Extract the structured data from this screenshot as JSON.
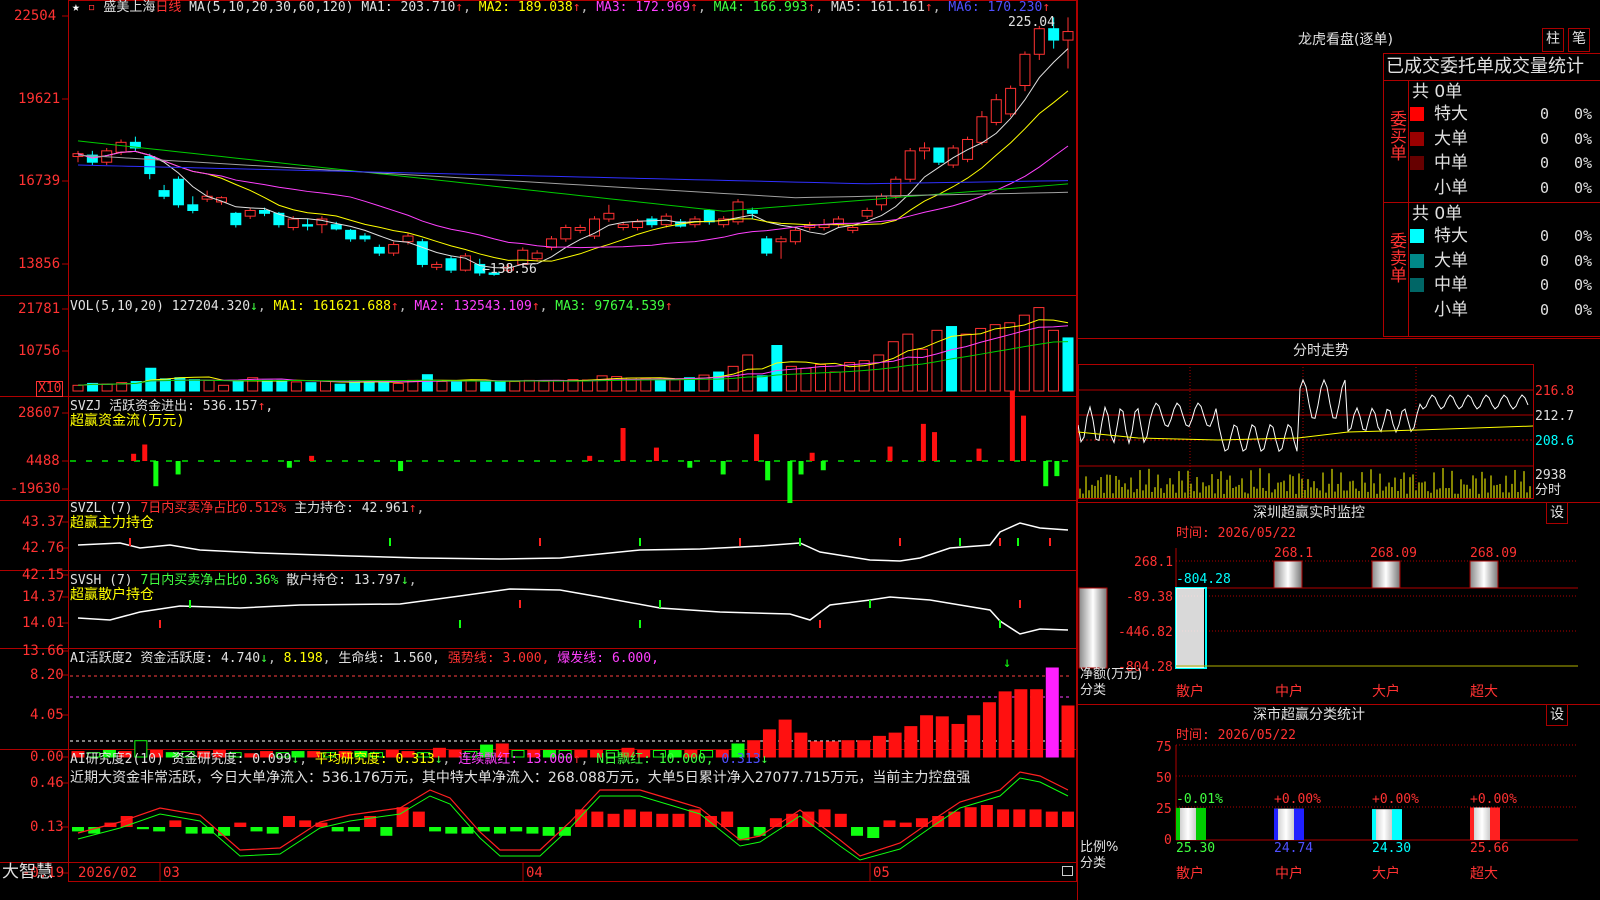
{
  "kline": {
    "stock_name": "盛美上海",
    "period": "日线",
    "ma_params": "MA(5,10,20,30,60,120)",
    "ma1": "MA1: 203.710",
    "ma2": "MA2: 189.038",
    "ma3": "MA3: 172.969",
    "ma4": "MA4: 166.993",
    "ma5": "MA5: 161.161",
    "ma6": "MA6: 170.230",
    "high_label": "225.04",
    "low_label": "←138.56",
    "y_ticks": [
      "22504",
      "19621",
      "16739",
      "13856"
    ]
  },
  "vol": {
    "header": "VOL(5,10,20)",
    "value": "127204.320",
    "ma1": "MA1: 161621.688",
    "ma2": "MA2: 132543.109",
    "ma3": "MA3: 97674.539",
    "y_ticks": [
      "21781",
      "10756"
    ],
    "unit_badge": "X10"
  },
  "svzj": {
    "header": "SVZJ  活跃资金进出: 536.157",
    "subtitle": "超赢资金流(万元)",
    "y_ticks": [
      "28607",
      "4488",
      "-19630"
    ]
  },
  "svzl": {
    "header_prefix": "SVZL (7)",
    "header_pct": "7日内买卖净占比0.512%",
    "header_val": "主力持仓: 42.961",
    "subtitle": "超赢主力持仓",
    "y_ticks": [
      "43.37",
      "42.76",
      "42.15"
    ]
  },
  "svsh": {
    "header_prefix": "SVSH (7)",
    "header_pct": "7日内买卖净占比0.36%",
    "header_val": "散户持仓: 13.797",
    "subtitle": "超赢散户持仓",
    "y_ticks": [
      "14.37",
      "14.01",
      "13.66"
    ]
  },
  "ai_active": {
    "header": "AI活跃度2",
    "v1": "资金活跃度: 4.740",
    "v2": "8.198",
    "v3": "生命线: 1.560,",
    "v4": "强势线: 3.000,",
    "v5": "爆发线: 6.000,",
    "y_ticks": [
      "8.20",
      "4.05",
      "0.00"
    ]
  },
  "ai_research": {
    "header": "AI研究度2(10)",
    "v1": "资金研究度: 0.099",
    "v2": "平均研究度: 0.313",
    "v3": "连续飘红: 13.000",
    "v4": "N日飘红: 10.000,",
    "v5": "0.313",
    "commentary": "近期大资金非常活跃，今日大单净流入：536.176万元，其中特大单净流入：268.088万元，大单5日累计净入27077.715万元，当前主力控盘强",
    "y_ticks": [
      "0.46",
      "0.13",
      "-0.19"
    ]
  },
  "time_axis": {
    "labels": [
      "2026/02",
      "03",
      "04",
      "05"
    ]
  },
  "brand": "大智慧",
  "dragon": {
    "title": "龙虎看盘(逐单)",
    "btn1": "柱",
    "btn2": "笔",
    "header": "已成交委托单成交量统计",
    "buy_label": "委买单",
    "sell_label": "委卖单",
    "buy_total": "共 0单",
    "sell_total": "共 0单",
    "buy_rows": [
      {
        "name": "特大",
        "val": "0",
        "pct": "0%",
        "color": "#ff0000"
      },
      {
        "name": "大单",
        "val": "0",
        "pct": "0%",
        "color": "#990000"
      },
      {
        "name": "中单",
        "val": "0",
        "pct": "0%",
        "color": "#660000"
      },
      {
        "name": "小单",
        "val": "0",
        "pct": "0%",
        "color": "#000000"
      }
    ],
    "sell_rows": [
      {
        "name": "特大",
        "val": "0",
        "pct": "0%",
        "color": "#00ffff"
      },
      {
        "name": "大单",
        "val": "0",
        "pct": "0%",
        "color": "#008888"
      },
      {
        "name": "中单",
        "val": "0",
        "pct": "0%",
        "color": "#006666"
      },
      {
        "name": "小单",
        "val": "0",
        "pct": "0%",
        "color": "#000000"
      }
    ]
  },
  "intraday": {
    "title": "分时走势",
    "y_ticks": [
      "216.8",
      "212.7",
      "208.6"
    ],
    "vol_tick": "2938",
    "vol_label": "分时"
  },
  "sz_monitor": {
    "title": "深圳超赢实时监控",
    "set_btn": "设",
    "time": "时间: 2026/05/22",
    "y_ticks": [
      "268.1",
      "-89.38",
      "-446.82",
      "-804.28"
    ],
    "bar_labels": [
      "-804.28",
      "268.1",
      "268.09",
      "268.09"
    ],
    "axis_label_1": "净额(万元)",
    "axis_label_2": "分类",
    "categories": [
      "散户",
      "中户",
      "大户",
      "超大"
    ]
  },
  "sz_classify": {
    "title": "深市超赢分类统计",
    "set_btn": "设",
    "time": "时间: 2026/05/22",
    "y_ticks": [
      "75",
      "50",
      "25",
      "0"
    ],
    "changes": [
      "-0.01%",
      "+0.00%",
      "+0.00%",
      "+0.00%"
    ],
    "values": [
      "25.30",
      "24.74",
      "24.30",
      "25.66"
    ],
    "axis_label_1": "比例%",
    "axis_label_2": "分类",
    "categories": [
      "散户",
      "中户",
      "大户",
      "超大"
    ],
    "colors": [
      "#00cc00",
      "#2020ff",
      "#00ffff",
      "#ff2020"
    ]
  },
  "chart_data": [
    {
      "type": "candlestick",
      "title": "盛美上海 日线",
      "ylim": [
        13200,
        23200
      ],
      "annotations": [
        "225.04",
        "←138.56"
      ],
      "candles": [
        [
          17900,
          18100,
          17700,
          18000
        ],
        [
          17950,
          18100,
          17600,
          17700
        ],
        [
          17700,
          18200,
          17600,
          18100
        ],
        [
          18050,
          18500,
          17950,
          18400
        ],
        [
          18400,
          18600,
          18100,
          18200
        ],
        [
          17900,
          18000,
          17100,
          17300
        ],
        [
          16700,
          16900,
          16400,
          16500
        ],
        [
          17100,
          17200,
          16100,
          16200
        ],
        [
          16200,
          16500,
          15900,
          16000
        ],
        [
          16400,
          16700,
          16300,
          16500
        ],
        [
          16300,
          16500,
          16200,
          16450
        ],
        [
          15900,
          15950,
          15400,
          15500
        ],
        [
          15800,
          16100,
          15700,
          16000
        ],
        [
          16000,
          16100,
          15800,
          15900
        ],
        [
          15900,
          15950,
          15400,
          15500
        ],
        [
          15400,
          15800,
          15300,
          15700
        ],
        [
          15500,
          15700,
          15300,
          15450
        ],
        [
          15500,
          15800,
          15200,
          15700
        ],
        [
          15500,
          15600,
          15300,
          15350
        ],
        [
          15300,
          15350,
          14900,
          15000
        ],
        [
          15100,
          15200,
          14900,
          15000
        ],
        [
          14700,
          14800,
          14400,
          14500
        ],
        [
          14500,
          14900,
          14400,
          14800
        ],
        [
          14900,
          15200,
          14800,
          15100
        ],
        [
          14900,
          15000,
          14000,
          14100
        ],
        [
          14000,
          14200,
          13900,
          14100
        ],
        [
          14300,
          14400,
          13800,
          13900
        ],
        [
          13900,
          14500,
          13850,
          14400
        ],
        [
          14100,
          14300,
          13700,
          13800
        ],
        [
          13800,
          13900,
          13700,
          13750
        ],
        [
          13900,
          14100,
          13800,
          14000
        ],
        [
          14100,
          14700,
          14050,
          14600
        ],
        [
          14300,
          14600,
          14200,
          14500
        ],
        [
          14700,
          15100,
          14600,
          15000
        ],
        [
          15000,
          15500,
          14900,
          15400
        ],
        [
          15300,
          15500,
          15200,
          15400
        ],
        [
          15100,
          15800,
          15000,
          15700
        ],
        [
          15700,
          16200,
          15600,
          15900
        ],
        [
          15400,
          15600,
          15300,
          15500
        ],
        [
          15400,
          15700,
          15300,
          15600
        ],
        [
          15700,
          15800,
          15400,
          15500
        ],
        [
          15500,
          15900,
          15400,
          15800
        ],
        [
          15600,
          15700,
          15400,
          15450
        ],
        [
          15500,
          15800,
          15400,
          15700
        ],
        [
          16000,
          16050,
          15500,
          15600
        ],
        [
          15500,
          15800,
          15400,
          15700
        ],
        [
          15600,
          16400,
          15500,
          16300
        ],
        [
          16000,
          16100,
          15700,
          15900
        ],
        [
          15000,
          15100,
          14400,
          14500
        ],
        [
          14900,
          15100,
          14300,
          15000
        ],
        [
          14900,
          15400,
          14800,
          15300
        ],
        [
          15400,
          15600,
          15300,
          15500
        ],
        [
          15400,
          15700,
          15300,
          15500
        ],
        [
          15500,
          15800,
          15400,
          15700
        ],
        [
          15300,
          15500,
          15200,
          15400
        ],
        [
          15800,
          16100,
          15700,
          16000
        ],
        [
          16200,
          16600,
          16000,
          16500
        ],
        [
          16500,
          17200,
          16400,
          17100
        ],
        [
          17100,
          18200,
          17000,
          18100
        ],
        [
          18100,
          18400,
          17800,
          18200
        ],
        [
          18200,
          17900,
          17600,
          17700
        ],
        [
          17600,
          18300,
          17500,
          18200
        ],
        [
          17800,
          18600,
          17700,
          18500
        ],
        [
          18400,
          19500,
          18300,
          19300
        ],
        [
          19100,
          20100,
          19000,
          19900
        ],
        [
          19400,
          20400,
          19300,
          20300
        ],
        [
          20400,
          21600,
          20200,
          21500
        ],
        [
          21500,
          22500,
          21300,
          22400
        ],
        [
          22400,
          22800,
          21700,
          22000
        ],
        [
          22000,
          22800,
          21000,
          22300
        ]
      ]
    },
    {
      "type": "bar",
      "title": "VOL(5,10,20)",
      "ylim": [
        0,
        24000
      ],
      "values": [
        1500,
        2000,
        1800,
        2200,
        2500,
        6000,
        3200,
        3500,
        3000,
        2800,
        1500,
        2600,
        3500,
        2800,
        2800,
        2400,
        2200,
        2600,
        1800,
        2700,
        2500,
        2500,
        2000,
        2800,
        4300,
        2500,
        2400,
        2800,
        2600,
        2600,
        2500,
        2800,
        2600,
        2800,
        3000,
        2900,
        4000,
        3800,
        3400,
        3200,
        3000,
        3000,
        3500,
        4200,
        5000,
        6500,
        9500,
        4000,
        12000,
        6500,
        6000,
        7000,
        5000,
        7500,
        8000,
        9500,
        13000,
        15000,
        11000,
        16000,
        17000,
        15000,
        16500,
        17500,
        18000,
        20000,
        22000,
        16000,
        14000
      ]
    },
    {
      "type": "bar",
      "title": "SVZJ 超赢资金流(万元)",
      "ylim": [
        -19630,
        28607
      ],
      "values": [
        0,
        0,
        0,
        0,
        0,
        3500,
        8000,
        -15000,
        0,
        -8000,
        0,
        0,
        0,
        0,
        0,
        0,
        0,
        0,
        0,
        -4000,
        0,
        2500,
        0,
        0,
        0,
        0,
        0,
        0,
        0,
        -6000,
        0,
        0,
        0,
        0,
        0,
        0,
        0,
        0,
        0,
        0,
        0,
        0,
        0,
        0,
        0,
        0,
        2500,
        0,
        0,
        16000,
        0,
        0,
        6500,
        0,
        0,
        -4000,
        0,
        0,
        -8000,
        0,
        0,
        13000,
        -11500,
        0,
        -25000,
        -8000,
        4000,
        -5500,
        0,
        0,
        0,
        0,
        0,
        7000,
        0,
        0,
        18000,
        14000,
        0,
        0,
        0,
        6000,
        0,
        0,
        34000,
        22000,
        0,
        -15000,
        -9000,
        0
      ]
    },
    {
      "type": "line",
      "title": "SVZL 超赢主力持仓",
      "ylim": [
        42.15,
        43.37
      ]
    },
    {
      "type": "line",
      "title": "SVSH 超赢散户持仓",
      "ylim": [
        13.66,
        14.37
      ]
    },
    {
      "type": "bar",
      "title": "AI活跃度2",
      "ylim": [
        0,
        8.2
      ]
    },
    {
      "type": "bar",
      "title": "AI研究度2(10)",
      "ylim": [
        -0.19,
        0.46
      ]
    }
  ]
}
